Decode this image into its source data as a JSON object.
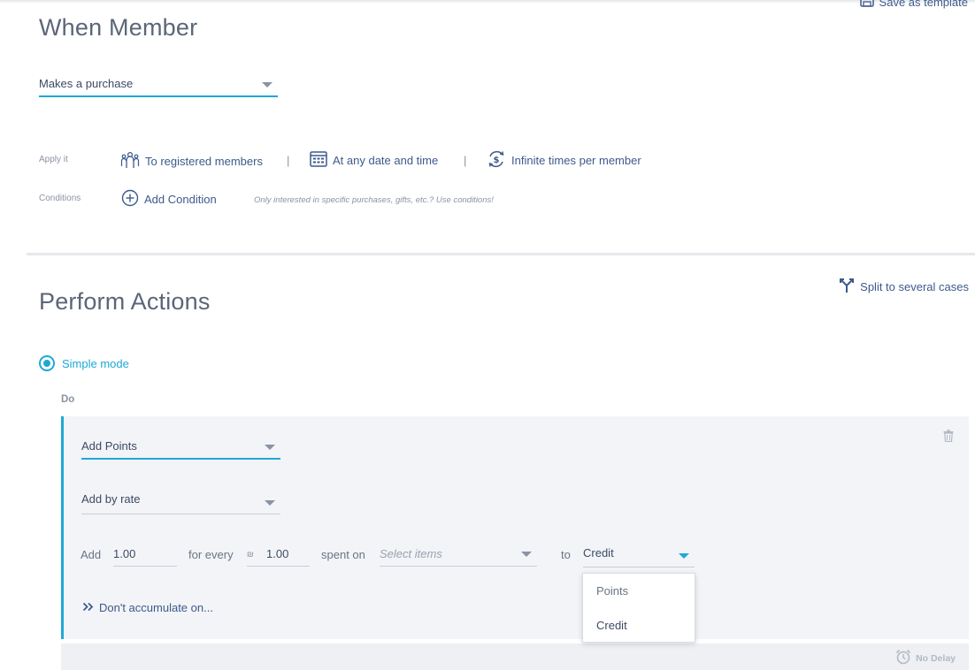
{
  "header": {
    "save_template": "Save as template"
  },
  "trigger": {
    "title": "When Member",
    "event": "Makes a purchase",
    "apply_label": "Apply it",
    "apply_registered": "To registered members",
    "apply_date": "At any date and time",
    "apply_times": "Infinite times per member",
    "separator": "|",
    "conditions_label": "Conditions",
    "add_condition": "Add Condition",
    "conditions_hint": "Only interested in specific purchases, gifts, etc.? Use conditions!"
  },
  "actions": {
    "title": "Perform Actions",
    "split": "Split to several cases",
    "mode": "Simple mode",
    "do_label": "Do",
    "action_type": "Add Points",
    "add_method": "Add by rate",
    "rate": {
      "add_label": "Add",
      "add_value": "1.00",
      "for_every_label": "for every",
      "currency_symbol": "₪",
      "for_every_value": "1.00",
      "spent_on_label": "spent on",
      "items_placeholder": "Select items",
      "to_label": "to",
      "to_value": "Credit"
    },
    "dropdown_options": [
      "Points",
      "Credit"
    ],
    "accumulate": "Don't accumulate on...",
    "no_delay": "No Delay"
  },
  "colors": {
    "accent": "#1fa8d6",
    "link": "#3d5a8c",
    "muted": "#8a93a3"
  },
  "icons": {
    "save": "save-icon",
    "people": "people-icon",
    "calendar": "calendar-icon",
    "repeat": "repeat-dollar-icon",
    "add": "plus-circle-icon",
    "split": "split-icon",
    "trash": "trash-icon",
    "chevrons": "double-chevron-right-icon",
    "alarm": "alarm-clock-icon"
  }
}
